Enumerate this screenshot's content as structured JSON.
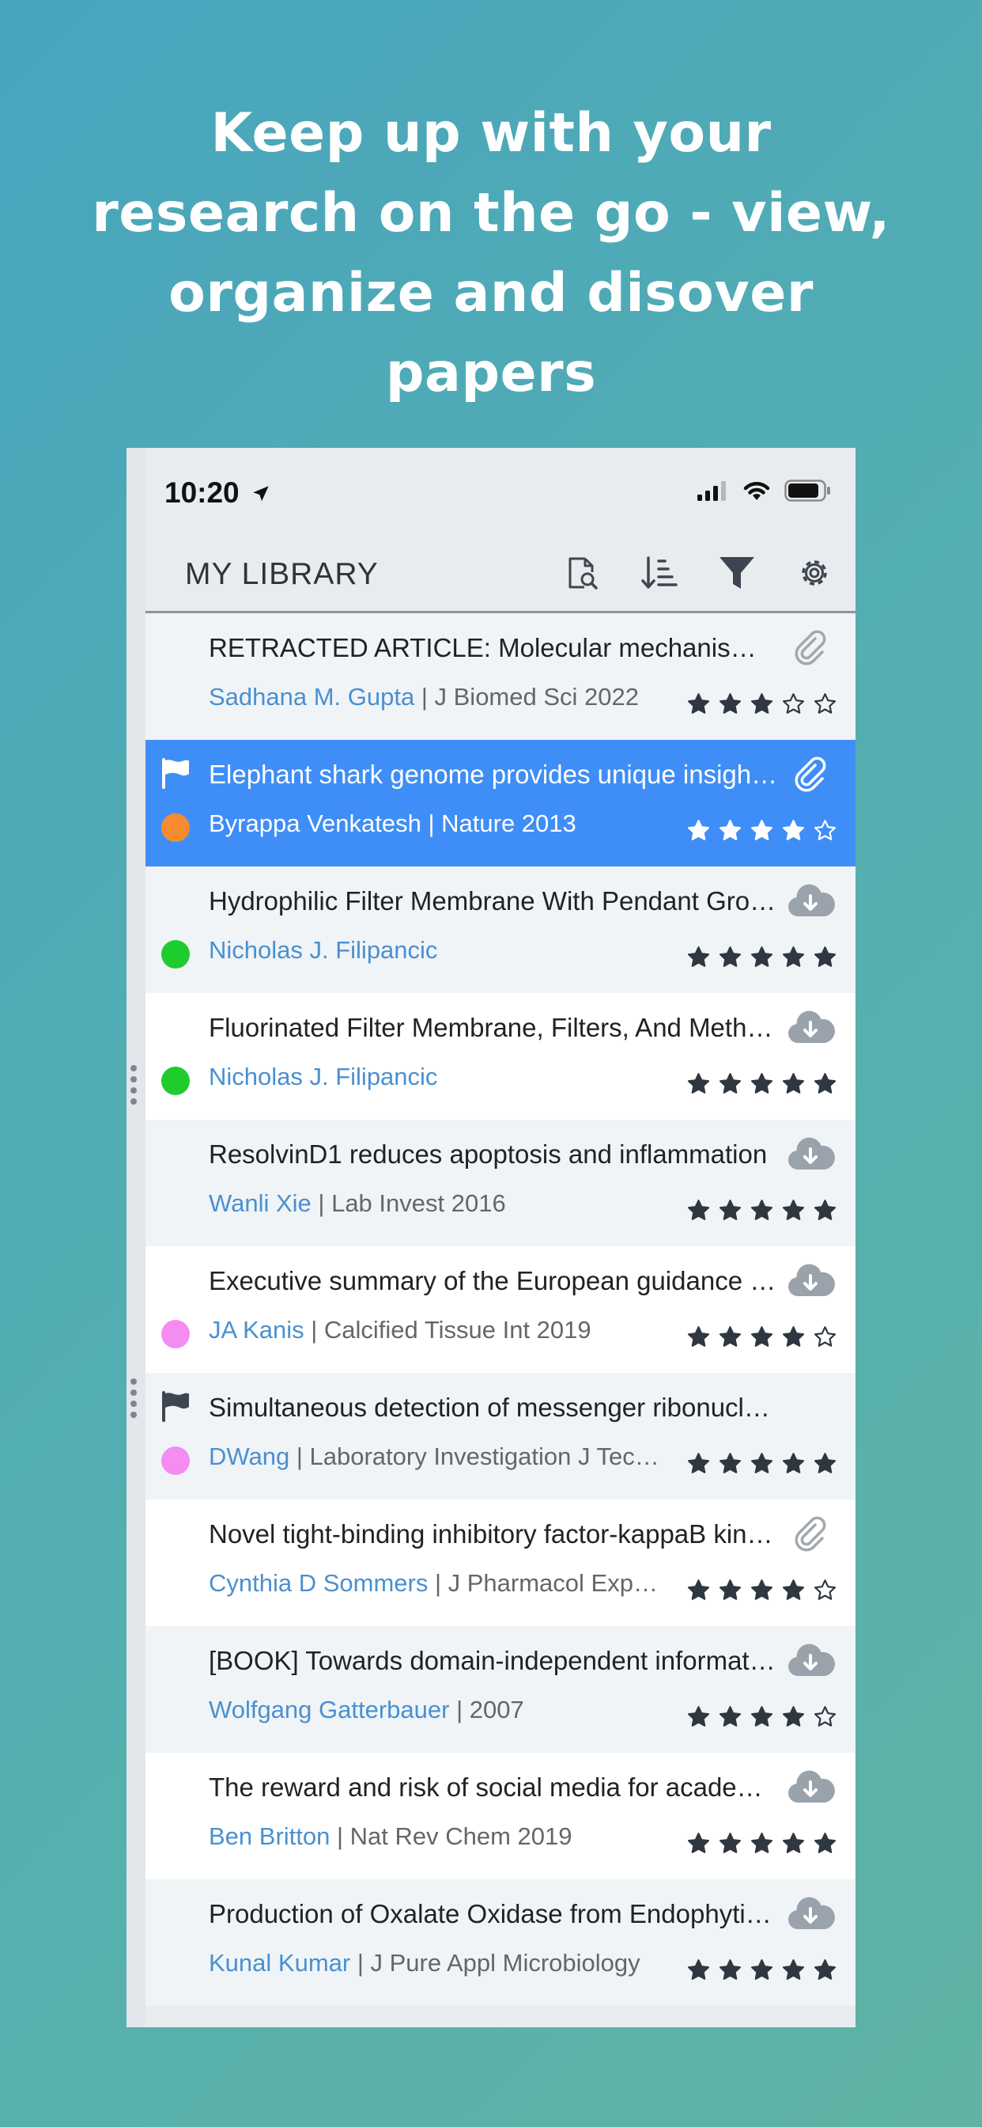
{
  "headline": [
    "Keep up with your",
    "research on the go - view,",
    "organize and disover",
    "papers"
  ],
  "status_bar": {
    "time": "10:20"
  },
  "toolbar": {
    "title": "MY LIBRARY",
    "icons": [
      "search-document-icon",
      "sort-icon",
      "filter-icon",
      "gear-icon"
    ]
  },
  "colors": {
    "selected_row": "#3f8ef7",
    "author": "#4a90cf",
    "dot_orange": "#f68c2f",
    "dot_green": "#1fcc2e",
    "dot_pink": "#f58cf0"
  },
  "papers": [
    {
      "title": "RETRACTED ARTICLE: Molecular mechanisms of neuroprotection",
      "author": "Sadhana M. Gupta",
      "source": " | J Biomed Sci 2022",
      "rating": 3,
      "icon": "paperclip",
      "dot": null,
      "flag": false,
      "selected": false
    },
    {
      "title": "Elephant shark genome provides unique insights into gnathostome evolution",
      "author": "Byrappa Venkatesh",
      "source": " | Nature 2013",
      "rating": 4,
      "icon": "paperclip",
      "dot": "dot_orange",
      "flag": true,
      "selected": true
    },
    {
      "title": "Hydrophilic Filter Membrane With Pendant Groups",
      "author": "Nicholas J. Filipancic",
      "source": "",
      "rating": 5,
      "icon": "cloud-download",
      "dot": "dot_green",
      "flag": false,
      "selected": false
    },
    {
      "title": "Fluorinated Filter Membrane, Filters, And Methods",
      "author": "Nicholas J. Filipancic",
      "source": "",
      "rating": 5,
      "icon": "cloud-download",
      "dot": "dot_green",
      "flag": false,
      "selected": false
    },
    {
      "title": "ResolvinD1 reduces apoptosis and inflammation",
      "author": "Wanli Xie",
      "source": " | Lab Invest 2016",
      "rating": 5,
      "icon": "cloud-download",
      "dot": null,
      "flag": false,
      "selected": false
    },
    {
      "title": "Executive summary of the European guidance for the diagnosis",
      "author": "JA Kanis",
      "source": " | Calcified Tissue Int 2019",
      "rating": 4,
      "icon": "cloud-download",
      "dot": "dot_pink",
      "flag": false,
      "selected": false
    },
    {
      "title": "Simultaneous detection of messenger ribonucleic acid",
      "author": "DWang",
      "source": " | Laboratory Investigation J Technical Methods",
      "rating": 5,
      "icon": null,
      "dot": "dot_pink",
      "flag": true,
      "selected": false
    },
    {
      "title": "Novel tight-binding inhibitory factor-kappaB kinase",
      "author": "Cynthia D Sommers",
      "source": " | J Pharmacol Exp Ther",
      "rating": 4,
      "icon": "paperclip",
      "dot": null,
      "flag": false,
      "selected": false
    },
    {
      "title": "[BOOK] Towards domain-independent information extraction",
      "author": "Wolfgang Gatterbauer",
      "source": " | 2007",
      "rating": 4,
      "icon": "cloud-download",
      "dot": null,
      "flag": false,
      "selected": false
    },
    {
      "title": "The reward and risk of social media for academics",
      "author": "Ben Britton",
      "source": " | Nat Rev Chem 2019",
      "rating": 5,
      "icon": "cloud-download",
      "dot": null,
      "flag": false,
      "selected": false
    },
    {
      "title": "Production of Oxalate Oxidase from Endophytic fungi",
      "author": "Kunal Kumar",
      "source": " | J Pure Appl Microbiology",
      "rating": 5,
      "icon": "cloud-download",
      "dot": null,
      "flag": false,
      "selected": false
    }
  ]
}
